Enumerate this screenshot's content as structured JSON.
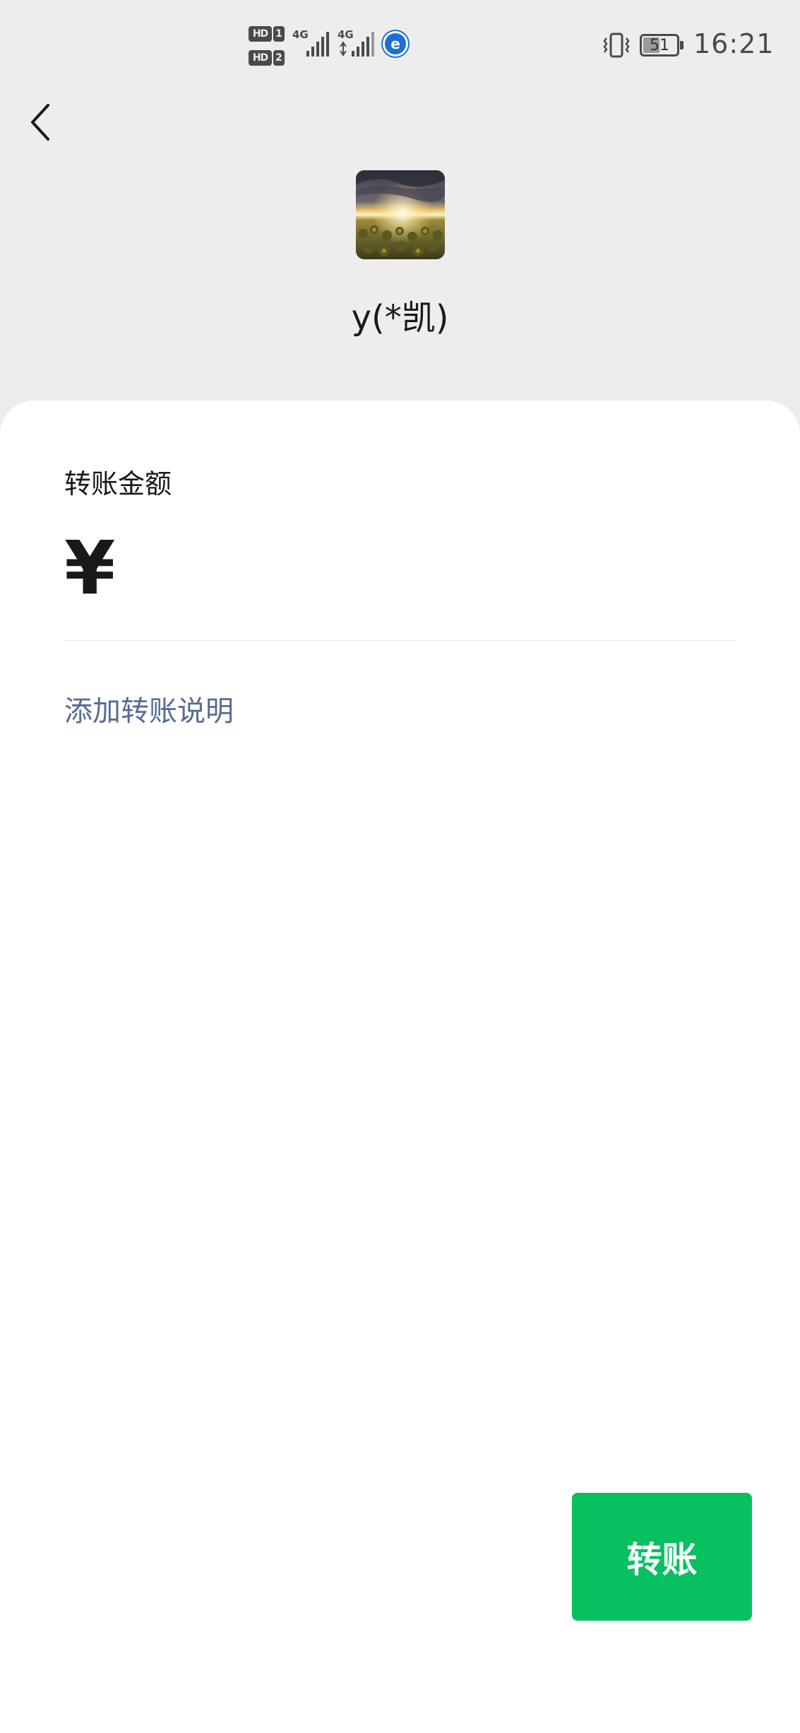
{
  "status_bar": {
    "hd_badges": [
      {
        "label": "HD",
        "sim": "1"
      },
      {
        "label": "HD",
        "sim": "2"
      }
    ],
    "signals": [
      {
        "network": "4G"
      },
      {
        "network": "4G"
      }
    ],
    "carrier_icon_letter": "e",
    "battery_level": "51",
    "battery_fraction": 0.51,
    "time": "16:21"
  },
  "header": {
    "back_icon": "chevron-left-icon",
    "payee_name": "y(*凯)"
  },
  "form": {
    "amount_label": "转账金额",
    "currency_symbol": "¥",
    "amount_value": "",
    "add_note_label": "添加转账说明"
  },
  "actions": {
    "transfer_label": "转账",
    "transfer_color": "#07c160"
  },
  "colors": {
    "background": "#ededed",
    "card": "#ffffff",
    "link": "#576b95"
  }
}
